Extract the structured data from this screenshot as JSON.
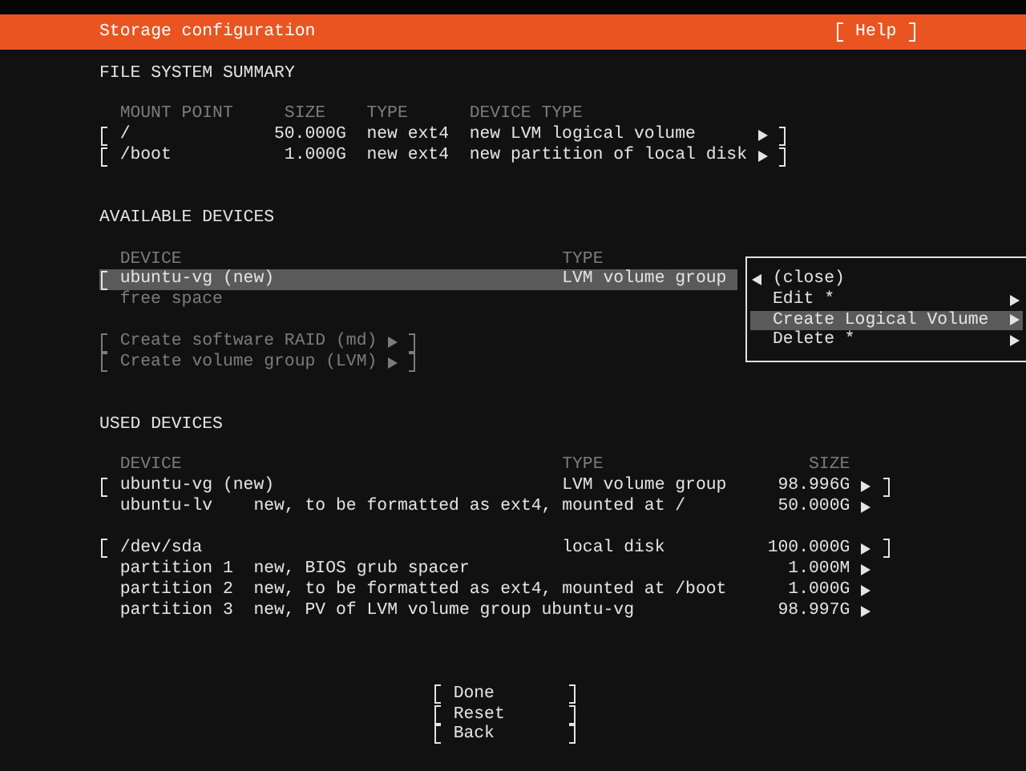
{
  "header": {
    "title": "Storage configuration",
    "help": "Help"
  },
  "file_system_summary": {
    "heading": "FILE SYSTEM SUMMARY",
    "columns": [
      "MOUNT POINT",
      "SIZE",
      "TYPE",
      "DEVICE TYPE"
    ],
    "rows": [
      {
        "mount_point": "/",
        "size": "50.000G",
        "type": "new ext4",
        "device_type": "new LVM logical volume"
      },
      {
        "mount_point": "/boot",
        "size": "1.000G",
        "type": "new ext4",
        "device_type": "new partition of local disk"
      }
    ]
  },
  "available_devices": {
    "heading": "AVAILABLE DEVICES",
    "columns": [
      "DEVICE",
      "TYPE"
    ],
    "devices": [
      {
        "name": "ubuntu-vg (new)",
        "type": "LVM volume group",
        "selected": true,
        "children": [
          {
            "name": "free space"
          }
        ]
      }
    ],
    "actions": [
      {
        "label": "Create software RAID (md)",
        "disabled": true
      },
      {
        "label": "Create volume group (LVM)",
        "disabled": true
      }
    ]
  },
  "context_menu": {
    "items": [
      {
        "label": "(close)",
        "kind": "back",
        "selected": false
      },
      {
        "label": "Edit *",
        "kind": "submenu",
        "selected": false
      },
      {
        "label": "Create Logical Volume",
        "kind": "submenu",
        "selected": true
      },
      {
        "label": "Delete *",
        "kind": "submenu",
        "selected": false
      }
    ]
  },
  "used_devices": {
    "heading": "USED DEVICES",
    "columns": [
      "DEVICE",
      "TYPE",
      "SIZE"
    ],
    "devices": [
      {
        "name": "ubuntu-vg (new)",
        "type": "LVM volume group",
        "size": "98.996G",
        "children": [
          {
            "name": "ubuntu-lv",
            "description": "new, to be formatted as ext4, mounted at /",
            "size": "50.000G"
          }
        ]
      },
      {
        "name": "/dev/sda",
        "type": "local disk",
        "size": "100.000G",
        "children": [
          {
            "name": "partition 1",
            "description": "new, BIOS grub spacer",
            "size": "1.000M"
          },
          {
            "name": "partition 2",
            "description": "new, to be formatted as ext4, mounted at /boot",
            "size": "1.000G"
          },
          {
            "name": "partition 3",
            "description": "new, PV of LVM volume group ubuntu-vg",
            "size": "98.997G"
          }
        ]
      }
    ]
  },
  "buttons": [
    {
      "label": "Done"
    },
    {
      "label": "Reset"
    },
    {
      "label": "Back"
    }
  ]
}
